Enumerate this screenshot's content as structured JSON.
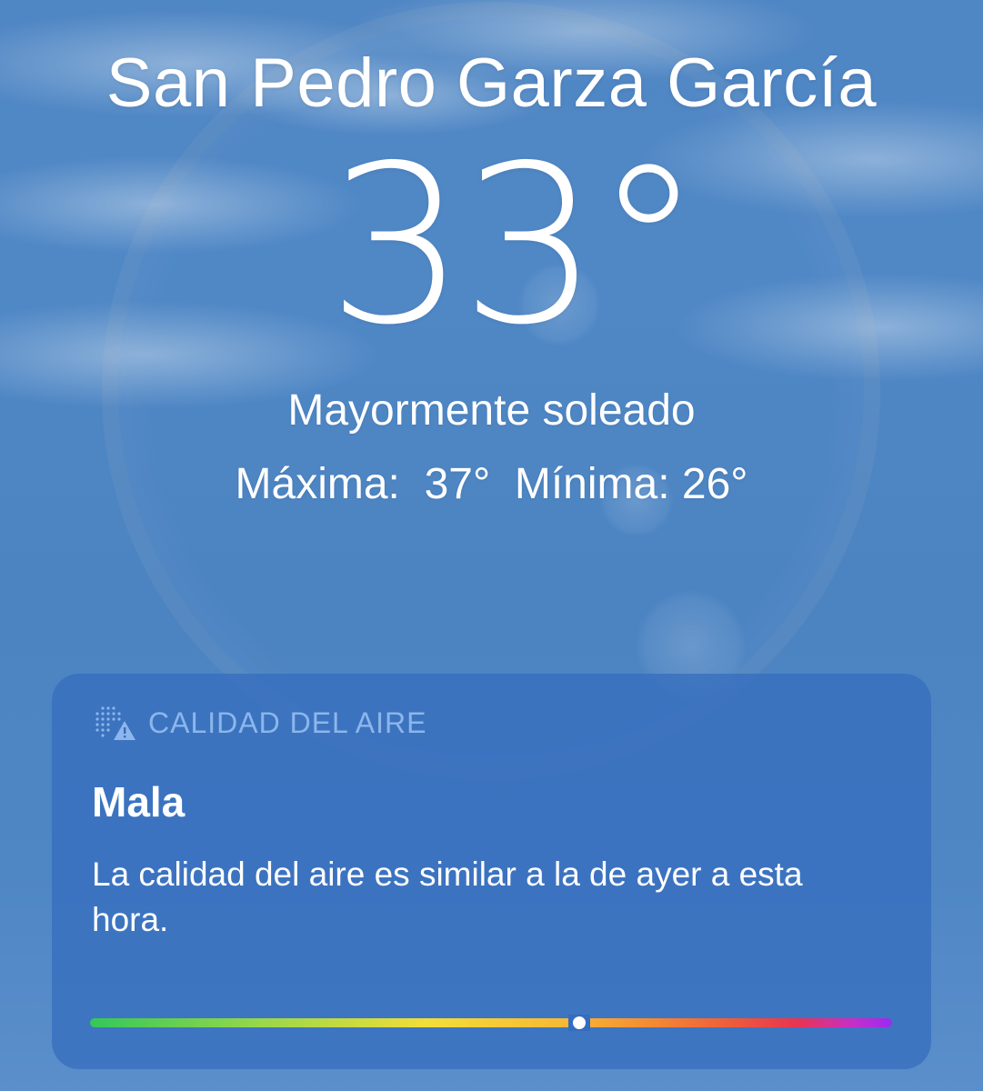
{
  "location": {
    "city": "San Pedro Garza García",
    "temperature": "33°",
    "condition": "Mayormente soleado",
    "high_label": "Máxima:",
    "high_value": "37°",
    "low_label": "Mínima:",
    "low_value": "26°"
  },
  "air_quality": {
    "icon": "air-quality-warning-icon",
    "title": "CALIDAD DEL AIRE",
    "status": "Mala",
    "description": "La calidad del aire es similar a la de ayer a esta hora.",
    "scale_position": 0.61,
    "scale_colors": [
      "#34c759",
      "#9bd84a",
      "#f2de38",
      "#f8b635",
      "#f48a33",
      "#ee5c3c",
      "#e8354f",
      "#c72fc6",
      "#9a2cf0"
    ]
  },
  "colors": {
    "sky": "#4f86c4",
    "card": "#346cbe",
    "card_title": "#8cb6ec",
    "text": "#ffffff"
  }
}
